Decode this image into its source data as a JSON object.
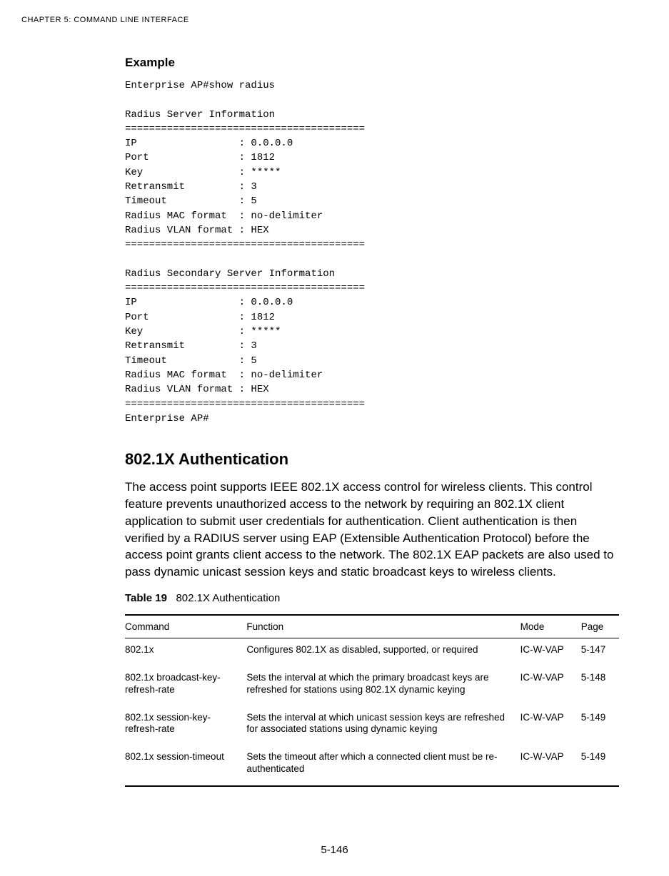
{
  "running_header": "CHAPTER 5: COMMAND LINE INTERFACE",
  "example_heading": "Example",
  "cli_output": "Enterprise AP#show radius\n\nRadius Server Information\n========================================\nIP                 : 0.0.0.0\nPort               : 1812\nKey                : *****\nRetransmit         : 3\nTimeout            : 5\nRadius MAC format  : no-delimiter\nRadius VLAN format : HEX\n========================================\n\nRadius Secondary Server Information\n========================================\nIP                 : 0.0.0.0\nPort               : 1812\nKey                : *****\nRetransmit         : 3\nTimeout            : 5\nRadius MAC format  : no-delimiter\nRadius VLAN format : HEX\n========================================\nEnterprise AP#",
  "section_heading": "802.1X Authentication",
  "body_paragraph": "The access point supports IEEE 802.1X access control for wireless clients. This control feature prevents unauthorized access to the network by requiring an 802.1X client application to submit user credentials for authentication. Client authentication is then verified by a RADIUS server using EAP (Extensible Authentication Protocol) before the access point grants client access to the network. The 802.1X EAP packets are also used to pass dynamic unicast session keys and static broadcast keys to wireless clients.",
  "table_caption_label": "Table 19",
  "table_caption_title": "802.1X Authentication",
  "table": {
    "headers": {
      "command": "Command",
      "function": "Function",
      "mode": "Mode",
      "page": "Page"
    },
    "rows": [
      {
        "command": "802.1x",
        "function": "Configures 802.1X as disabled, supported, or required",
        "mode": "IC-W-VAP",
        "page": "5-147"
      },
      {
        "command": "802.1x broadcast-key-refresh-rate",
        "function": "Sets the interval at which the primary broadcast keys are refreshed for stations using 802.1X dynamic keying",
        "mode": "IC-W-VAP",
        "page": "5-148"
      },
      {
        "command": "802.1x session-key-refresh-rate",
        "function": "Sets the interval at which unicast session keys are refreshed for associated stations using dynamic keying",
        "mode": "IC-W-VAP",
        "page": "5-149"
      },
      {
        "command": "802.1x session-timeout",
        "function": "Sets the timeout after which a connected client must be re-authenticated",
        "mode": "IC-W-VAP",
        "page": "5-149"
      }
    ]
  },
  "page_number": "5-146"
}
